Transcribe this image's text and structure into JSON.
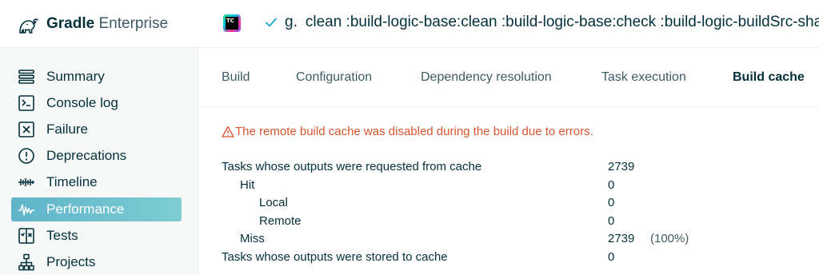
{
  "header": {
    "brand_bold": "Gradle",
    "brand_light": "Enterprise",
    "ci_badge_text": "TC",
    "project_name": "g.",
    "build_tasks": "clean :build-logic-base:clean :build-logic-base:check :build-logic-buildSrc-shared"
  },
  "sidebar": {
    "items": [
      {
        "label": "Summary",
        "icon": "summary-icon"
      },
      {
        "label": "Console log",
        "icon": "console-icon"
      },
      {
        "label": "Failure",
        "icon": "failure-icon"
      },
      {
        "label": "Deprecations",
        "icon": "deprecations-icon"
      },
      {
        "label": "Timeline",
        "icon": "timeline-icon"
      },
      {
        "label": "Performance",
        "icon": "performance-icon",
        "active": true
      },
      {
        "label": "Tests",
        "icon": "tests-icon"
      },
      {
        "label": "Projects",
        "icon": "projects-icon"
      }
    ]
  },
  "tabs": [
    {
      "label": "Build"
    },
    {
      "label": "Configuration"
    },
    {
      "label": "Dependency resolution"
    },
    {
      "label": "Task execution"
    },
    {
      "label": "Build cache",
      "active": true
    }
  ],
  "warning": "The remote build cache was disabled during the build due to errors.",
  "stats": [
    {
      "label": "Tasks whose outputs were requested from cache",
      "value": "2739",
      "extra": ""
    },
    {
      "label": "Hit",
      "value": "0",
      "extra": ""
    },
    {
      "label": "Local",
      "value": "0",
      "extra": ""
    },
    {
      "label": "Remote",
      "value": "0",
      "extra": ""
    },
    {
      "label": "Miss",
      "value": "2739",
      "extra": "(100%)"
    },
    {
      "label": "Tasks whose outputs were stored to cache",
      "value": "0",
      "extra": ""
    }
  ],
  "colors": {
    "accent": "#5fb4c9",
    "warning": "#d9532f",
    "success": "#1ba8cb",
    "text": "#02303a"
  }
}
